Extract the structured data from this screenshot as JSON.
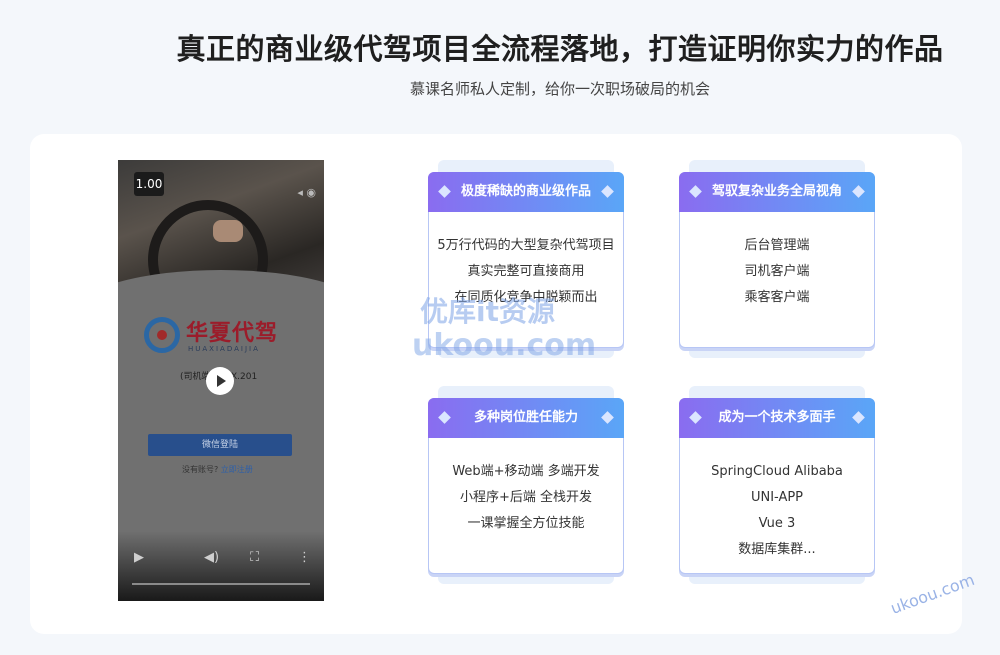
{
  "header": {
    "title": "真正的商业级代驾项目全流程落地，打造证明你实力的作品",
    "subtitle": "慕课名师私人定制，给你一次职场破局的机会"
  },
  "video": {
    "speed_label": "1.00",
    "logo_cn": "华夏代驾",
    "logo_en": "HUAXIADAIJIA",
    "version_line": "(司机端 20XX.201",
    "login_button": "微信登陆",
    "register_prompt": "没有账号?",
    "register_link": "立即注册"
  },
  "cards": [
    {
      "title": "极度稀缺的商业级作品",
      "lines": [
        "5万行代码的大型复杂代驾项目",
        "真实完整可直接商用",
        "在同质化竞争中脱颖而出"
      ]
    },
    {
      "title": "驾驭复杂业务全局视角",
      "lines": [
        "后台管理端",
        "司机客户端",
        "乘客客户端"
      ]
    },
    {
      "title": "多种岗位胜任能力",
      "lines": [
        "Web端+移动端 多端开发",
        "小程序+后端 全栈开发",
        "一课掌握全方位技能"
      ]
    },
    {
      "title": "成为一个技术多面手",
      "lines": [
        "SpringCloud Alibaba",
        "UNI-APP",
        "Vue 3",
        "数据库集群..."
      ]
    }
  ],
  "watermark": {
    "line1": "优库it资源",
    "line2": "ukoou.com",
    "corner": "ukoou.com"
  },
  "colors": {
    "accent_gradient_start": "#8a6cf0",
    "accent_gradient_end": "#5aa6f7",
    "login_button": "#284f8c"
  },
  "icons": [
    "play-icon",
    "volume-icon",
    "fullscreen-icon",
    "more-icon",
    "diamond-icon"
  ]
}
